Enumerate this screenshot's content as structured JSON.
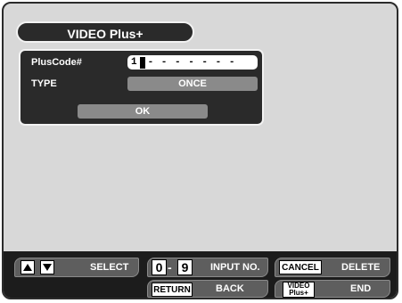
{
  "title": "VIDEO Plus+",
  "form": {
    "pluscode_label": "PlusCode#",
    "pluscode_value": "1",
    "pluscode_rest": "- - - - - - -",
    "type_label": "TYPE",
    "type_value": "ONCE",
    "ok_label": "OK"
  },
  "controls": {
    "select_label": "SELECT",
    "digit_start": "0",
    "digit_dash": "-",
    "digit_end": "9",
    "input_label": "INPUT NO.",
    "cancel_key": "CANCEL",
    "delete_label": "DELETE",
    "return_key": "RETURN",
    "back_label": "BACK",
    "videoplus_key_line1": "VIDEO",
    "videoplus_key_line2": "Plus+",
    "end_label": "END"
  },
  "icons": {
    "up": "triangle-up-icon",
    "down": "triangle-down-icon"
  }
}
